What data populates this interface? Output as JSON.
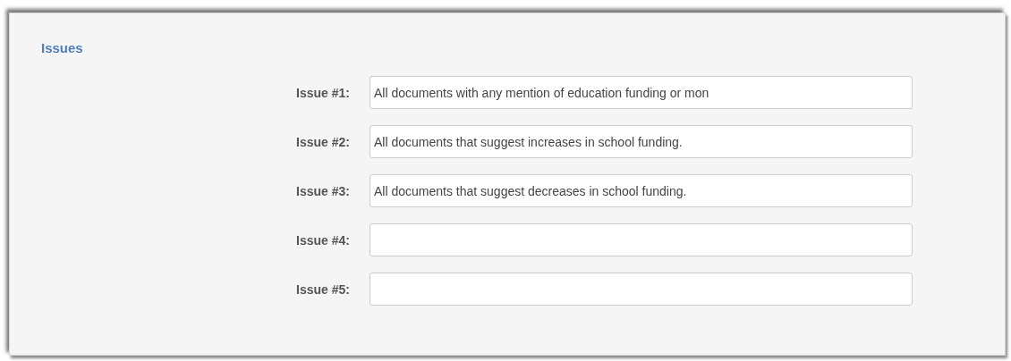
{
  "section": {
    "title": "Issues"
  },
  "issues": [
    {
      "label": "Issue #1:",
      "value": "All documents with any mention of education funding or mon"
    },
    {
      "label": "Issue #2:",
      "value": "All documents that suggest increases in school funding."
    },
    {
      "label": "Issue #3:",
      "value": "All documents that suggest decreases in school funding."
    },
    {
      "label": "Issue #4:"
    },
    {
      "label": "Issue #5:"
    }
  ]
}
